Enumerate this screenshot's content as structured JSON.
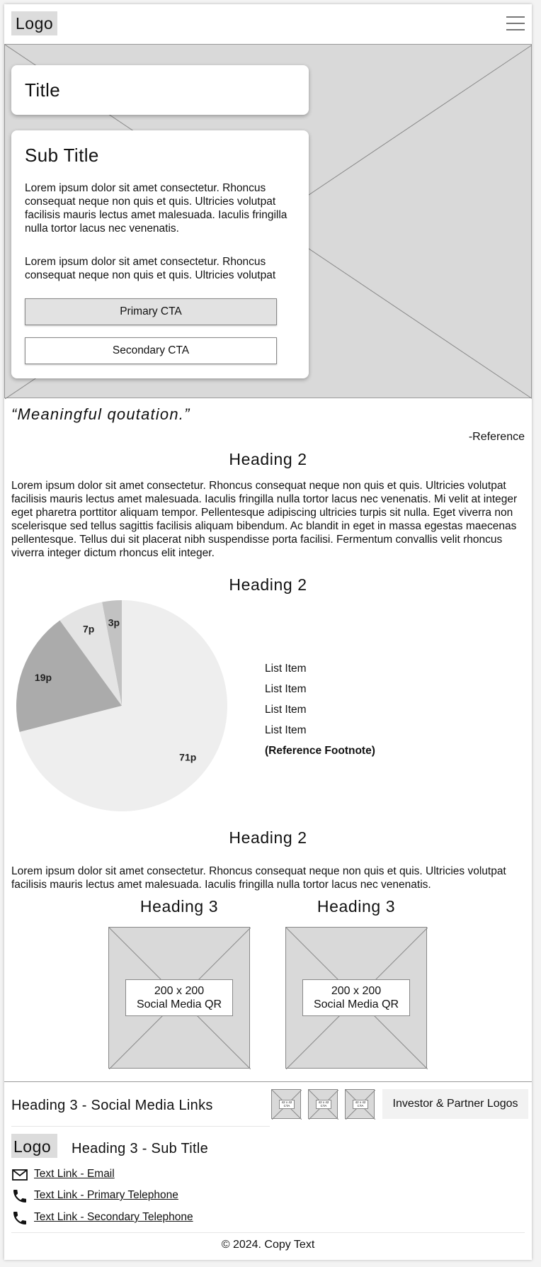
{
  "header": {
    "logo": "Logo",
    "menu_icon": "hamburger-menu-icon"
  },
  "hero": {
    "title": "Title",
    "subtitle": "Sub Title",
    "paragraph1": "Lorem ipsum dolor sit amet consectetur. Rhoncus consequat neque non quis et quis. Ultricies volutpat facilisis mauris lectus amet malesuada. Iaculis fringilla nulla tortor lacus nec venenatis.",
    "paragraph2": "Lorem ipsum dolor sit amet consectetur. Rhoncus consequat neque non quis et quis. Ultricies volutpat",
    "primary_cta": "Primary CTA",
    "secondary_cta": "Secondary CTA"
  },
  "quote": {
    "text": "“Meaningful qoutation.”",
    "reference": "-Reference"
  },
  "section1": {
    "heading": "Heading 2",
    "body": "Lorem ipsum dolor sit amet consectetur. Rhoncus consequat neque non quis et quis. Ultricies volutpat facilisis mauris lectus amet malesuada. Iaculis fringilla nulla tortor lacus nec venenatis. Mi velit at integer eget pharetra porttitor aliquam tempor. Pellentesque adipiscing ultricies turpis sit nulla. Eget viverra non scelerisque sed tellus sagittis facilisis aliquam bibendum. Ac blandit in eget in massa egestas maecenas pellentesque. Tellus dui sit placerat nibh suspendisse porta facilisi. Fermentum convallis velit rhoncus viverra integer dictum rhoncus elit integer."
  },
  "section2": {
    "heading": "Heading 2",
    "list": [
      "List Item",
      "List Item",
      "List Item",
      "List Item"
    ],
    "footnote": "(Reference Footnote)"
  },
  "chart_data": {
    "type": "pie",
    "slices": [
      {
        "label": "71p",
        "value": 71,
        "color": "#eeeeee"
      },
      {
        "label": "19p",
        "value": 19,
        "color": "#ababab"
      },
      {
        "label": "7p",
        "value": 7,
        "color": "#e4e4e4"
      },
      {
        "label": "3p",
        "value": 3,
        "color": "#c2c2c2"
      }
    ]
  },
  "section3": {
    "heading": "Heading 2",
    "body": "Lorem ipsum dolor sit amet consectetur. Rhoncus consequat neque non quis et quis. Ultricies volutpat facilisis mauris lectus amet malesuada. Iaculis fringilla nulla tortor lacus nec venenatis.",
    "qr_cards": [
      {
        "heading": "Heading 3",
        "label_line1": "200 x 200",
        "label_line2": "Social Media QR"
      },
      {
        "heading": "Heading 3",
        "label_line1": "200 x 200",
        "label_line2": "Social Media QR"
      }
    ]
  },
  "footer": {
    "social_heading": "Heading 3 - Social Media Links",
    "mini_ctas": [
      {
        "line1": "42 x 42",
        "line2": "CTA"
      },
      {
        "line1": "42 x 42",
        "line2": "CTA"
      },
      {
        "line1": "42 x 42",
        "line2": "CTA"
      }
    ],
    "partners": "Investor & Partner Logos",
    "logo": "Logo",
    "subtitle": "Heading 3 - Sub Title",
    "email": "Text Link - Email",
    "primary_phone": "Text Link - Primary Telephone",
    "secondary_phone": "Text Link - Secondary Telephone",
    "copyright": "© 2024. Copy Text"
  }
}
